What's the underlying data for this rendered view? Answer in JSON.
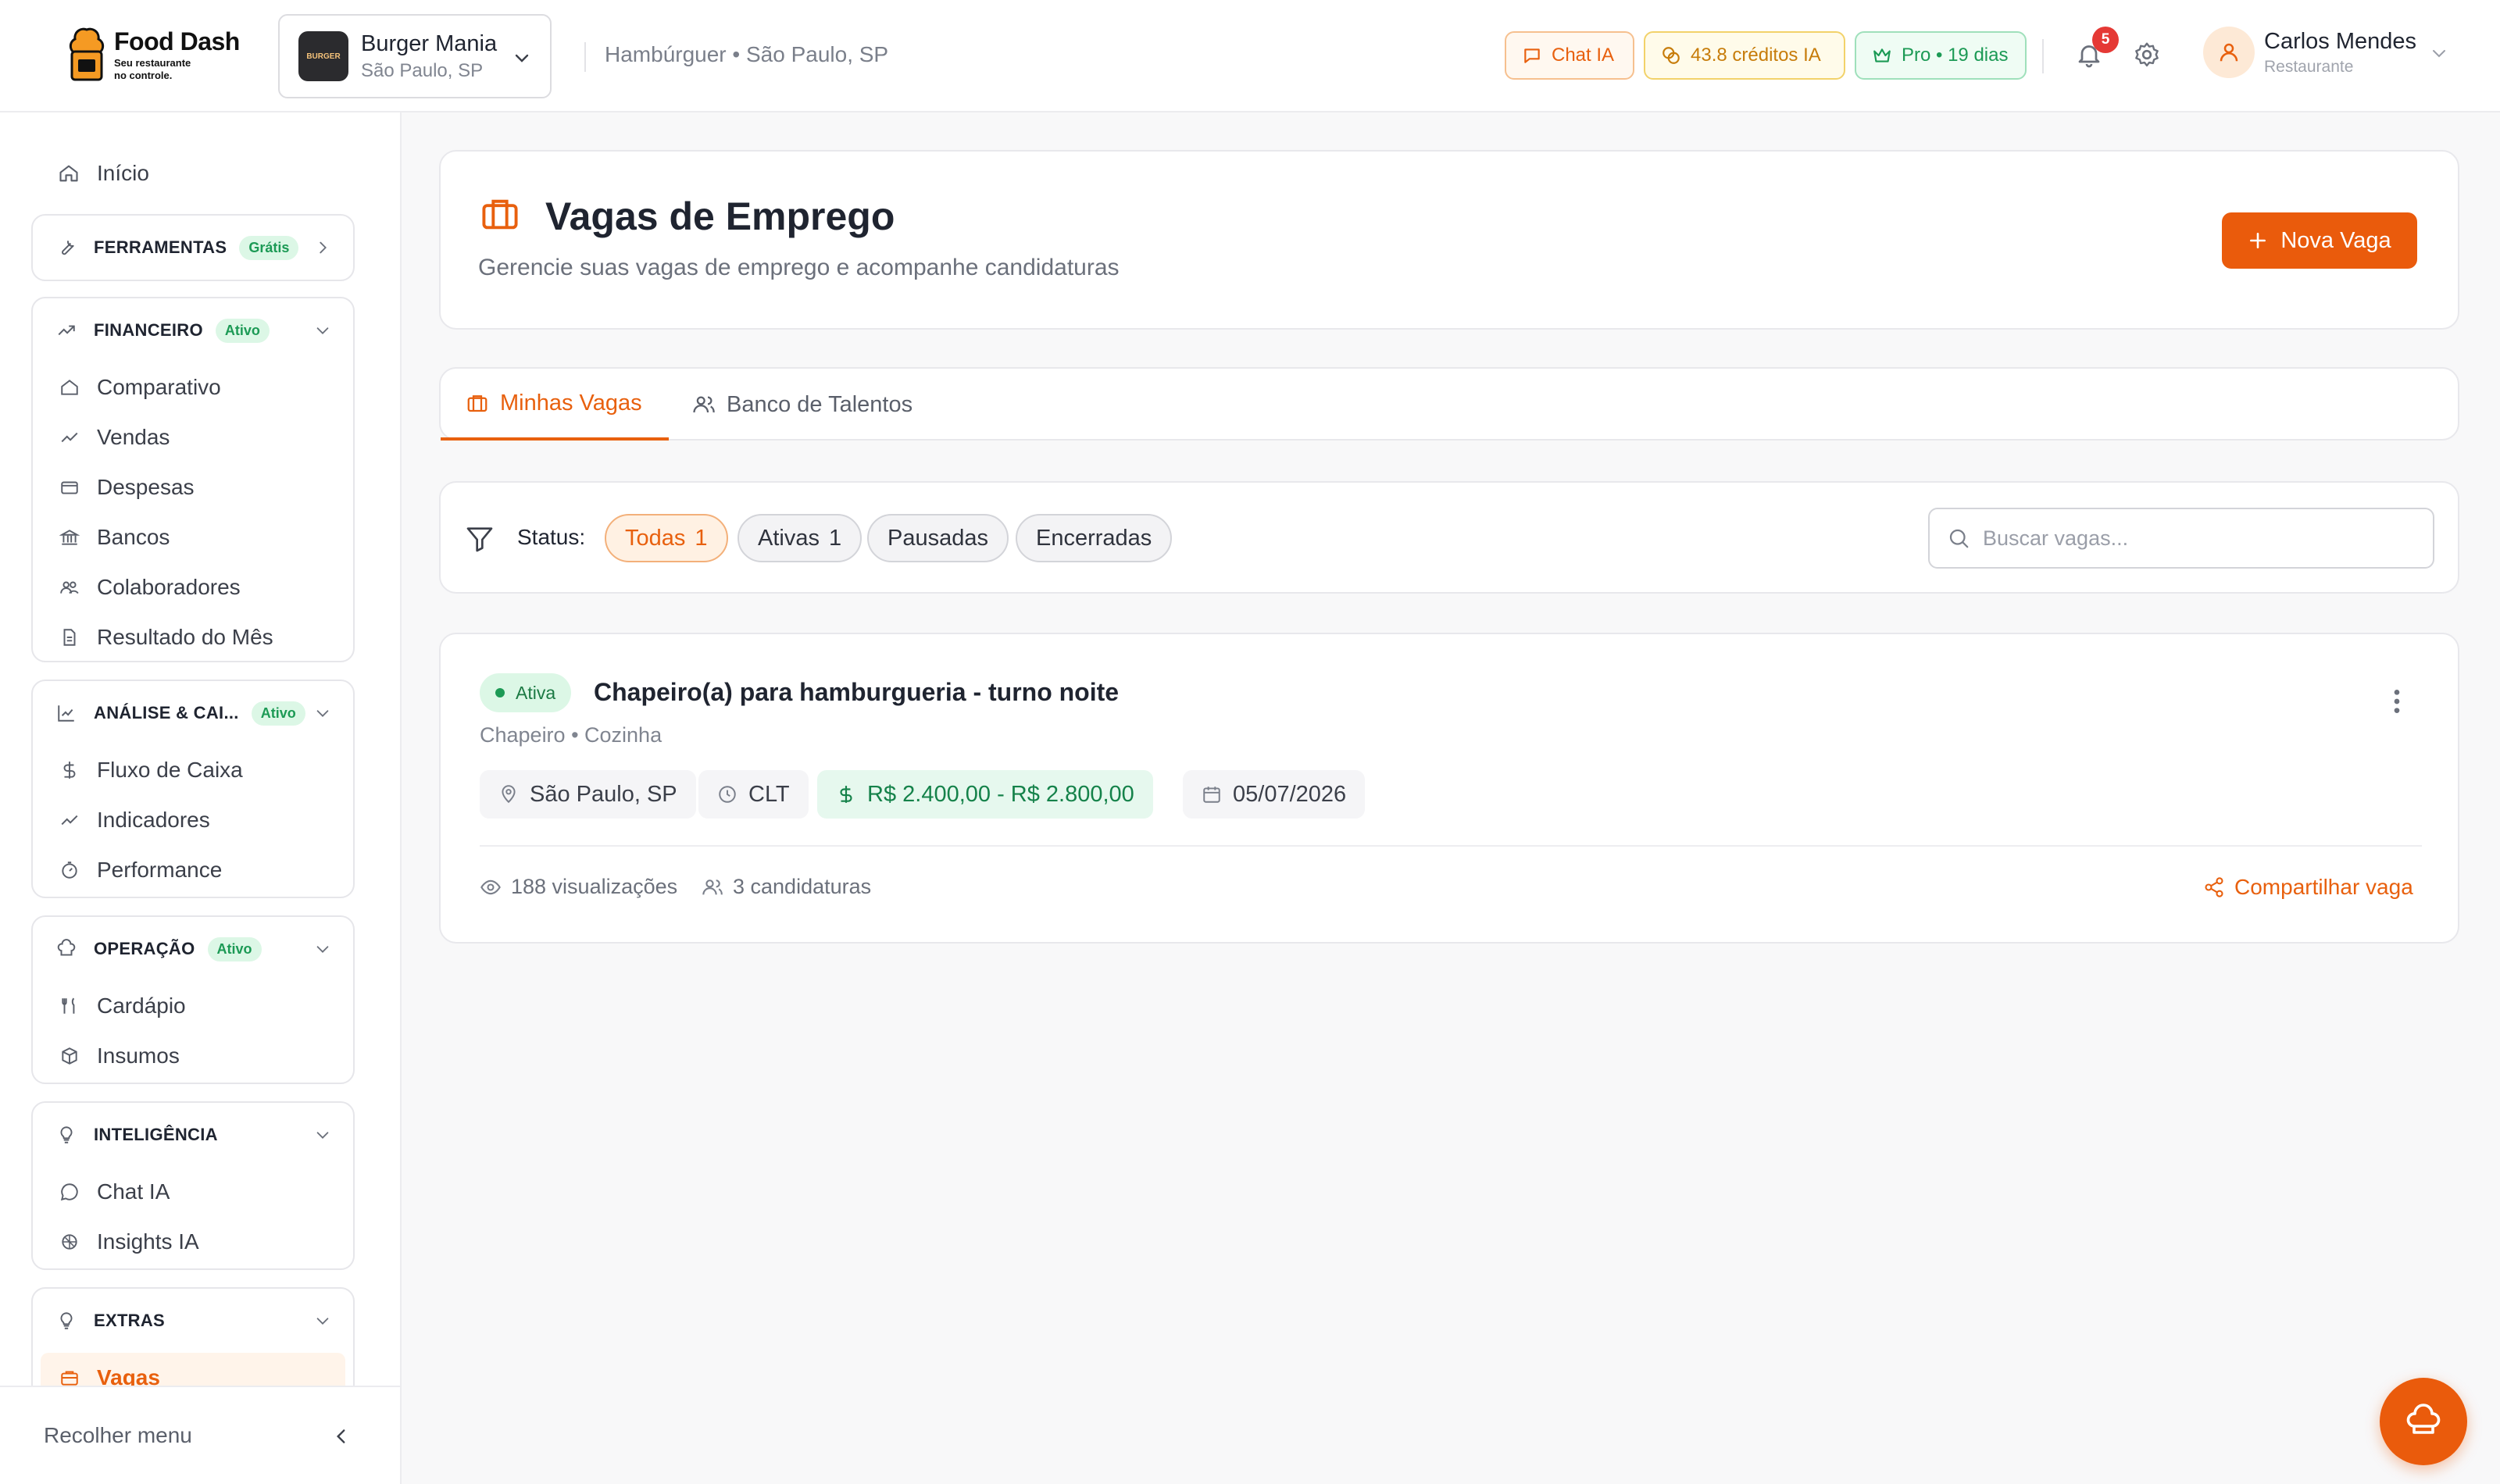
{
  "brand": {
    "name": "Food Dash",
    "tagline_1": "Seu restaurante",
    "tagline_2": "no controle."
  },
  "restaurant": {
    "name": "Burger Mania",
    "city": "São Paulo, SP",
    "logo_text": "BURGER"
  },
  "breadcrumb": "Hambúrguer • São Paulo, SP",
  "header": {
    "chat_label": "Chat IA",
    "credits_label": "43.8 créditos IA",
    "plan_label": "Pro • 19 dias",
    "notifications_count": "5",
    "user_name": "Carlos Mendes",
    "user_role": "Restaurante"
  },
  "sidebar": {
    "home": "Início",
    "tools": {
      "title": "FERRAMENTAS",
      "tag": "Grátis"
    },
    "financeiro": {
      "title": "FINANCEIRO",
      "tag": "Ativo",
      "items": [
        "Comparativo",
        "Vendas",
        "Despesas",
        "Bancos",
        "Colaboradores",
        "Resultado do Mês"
      ]
    },
    "analise": {
      "title": "ANÁLISE & CAI...",
      "tag": "Ativo",
      "items": [
        "Fluxo de Caixa",
        "Indicadores",
        "Performance"
      ]
    },
    "operacao": {
      "title": "OPERAÇÃO",
      "tag": "Ativo",
      "items": [
        "Cardápio",
        "Insumos"
      ]
    },
    "inteligencia": {
      "title": "INTELIGÊNCIA",
      "items": [
        "Chat IA",
        "Insights IA"
      ]
    },
    "extras": {
      "title": "EXTRAS",
      "items": [
        "Vagas"
      ]
    },
    "collapse": "Recolher menu"
  },
  "page": {
    "title": "Vagas de Emprego",
    "subtitle": "Gerencie suas vagas de emprego e acompanhe candidaturas",
    "new_button": "Nova Vaga",
    "tabs": [
      "Minhas Vagas",
      "Banco de Talentos"
    ]
  },
  "filters": {
    "label": "Status:",
    "chips": [
      {
        "label": "Todas",
        "count": "1"
      },
      {
        "label": "Ativas",
        "count": "1"
      },
      {
        "label": "Pausadas"
      },
      {
        "label": "Encerradas"
      }
    ],
    "search_placeholder": "Buscar vagas..."
  },
  "job": {
    "status": "Ativa",
    "title": "Chapeiro(a) para hamburgueria - turno noite",
    "meta": "Chapeiro • Cozinha",
    "location": "São Paulo, SP",
    "contract": "CLT",
    "salary": "R$ 2.400,00 - R$ 2.800,00",
    "date": "05/07/2026",
    "views": "188 visualizações",
    "applications": "3 candidaturas",
    "share": "Compartilhar vaga"
  },
  "colors": {
    "accent": "#ea5b0c",
    "success": "#1c9a55",
    "warning": "#c77c0a"
  },
  "icons": [
    "chef-hat-icon",
    "chevron-down-icon",
    "chat-icon",
    "coins-icon",
    "crown-icon",
    "bell-icon",
    "gear-icon",
    "user-icon",
    "home-icon",
    "wrench-icon",
    "trend-icon",
    "briefcase-icon",
    "users-icon",
    "filter-icon",
    "search-icon",
    "map-pin-icon",
    "clock-icon",
    "dollar-icon",
    "calendar-icon",
    "eye-icon",
    "share-icon",
    "kebab-icon"
  ]
}
